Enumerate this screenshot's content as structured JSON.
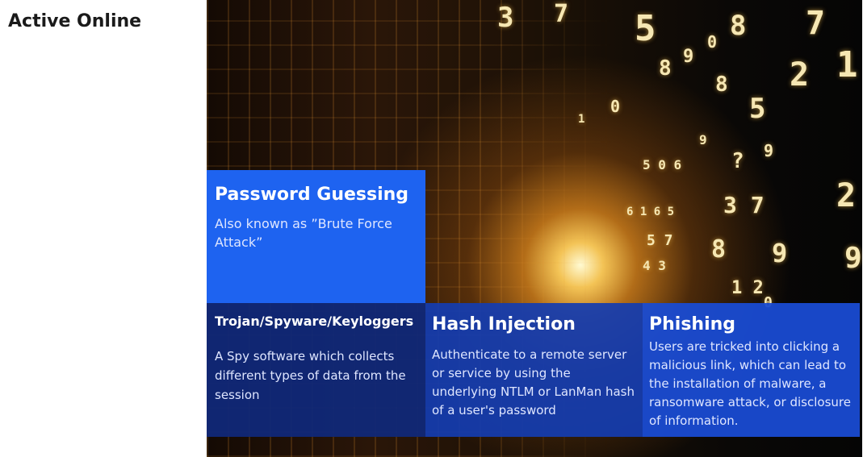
{
  "page": {
    "title": "Active Online"
  },
  "cards": {
    "password_guessing": {
      "title": "Password Guessing",
      "desc": "Also known as ”Brute Force Attack”"
    },
    "trojan": {
      "title": "Trojan/Spyware/Keyloggers",
      "desc": "A Spy software which collects different types of data from the session"
    },
    "hash_injection": {
      "title": "Hash Injection",
      "desc": "Authenticate to a remote server or service by using the underlying NTLM or LanMan hash of a user's password"
    },
    "phishing": {
      "title": "Phishing",
      "desc": "Users are tricked into clicking a malicious link, which can lead to the installation of malware, a ransomware attack, or disclosure of information."
    }
  },
  "colors": {
    "password_guessing_bg": "#1e63f0",
    "trojan_bg": "#10287a",
    "hash_injection_bg": "#143caf",
    "phishing_bg": "#194bd2"
  }
}
